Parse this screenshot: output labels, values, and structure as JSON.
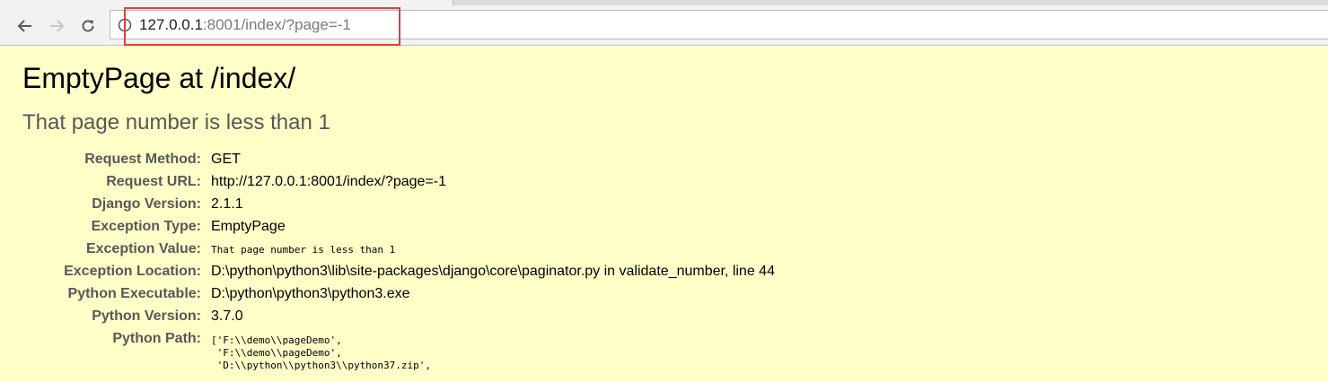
{
  "browser": {
    "url_host": "127.0.0.1",
    "url_rest": ":8001/index/?page=-1"
  },
  "error": {
    "title": "EmptyPage at /index/",
    "subtitle": "That page number is less than 1"
  },
  "meta": [
    {
      "label": "Request Method:",
      "value": "GET"
    },
    {
      "label": "Request URL:",
      "value": "http://127.0.0.1:8001/index/?page=-1"
    },
    {
      "label": "Django Version:",
      "value": "2.1.1"
    },
    {
      "label": "Exception Type:",
      "value": "EmptyPage"
    },
    {
      "label": "Exception Value:",
      "value": "That page number is less than 1"
    },
    {
      "label": "Exception Location:",
      "value": "D:\\python\\python3\\lib\\site-packages\\django\\core\\paginator.py in validate_number, line 44"
    },
    {
      "label": "Python Executable:",
      "value": "D:\\python\\python3\\python3.exe"
    },
    {
      "label": "Python Version:",
      "value": "3.7.0"
    },
    {
      "label": "Python Path:",
      "value": ""
    }
  ],
  "python_path": [
    "['F:\\\\demo\\\\pageDemo',",
    " 'F:\\\\demo\\\\pageDemo',",
    " 'D:\\\\python\\\\python3\\\\python37.zip',"
  ],
  "colors": {
    "page_bg": "#ffffc8",
    "highlight": "#d9433c"
  }
}
